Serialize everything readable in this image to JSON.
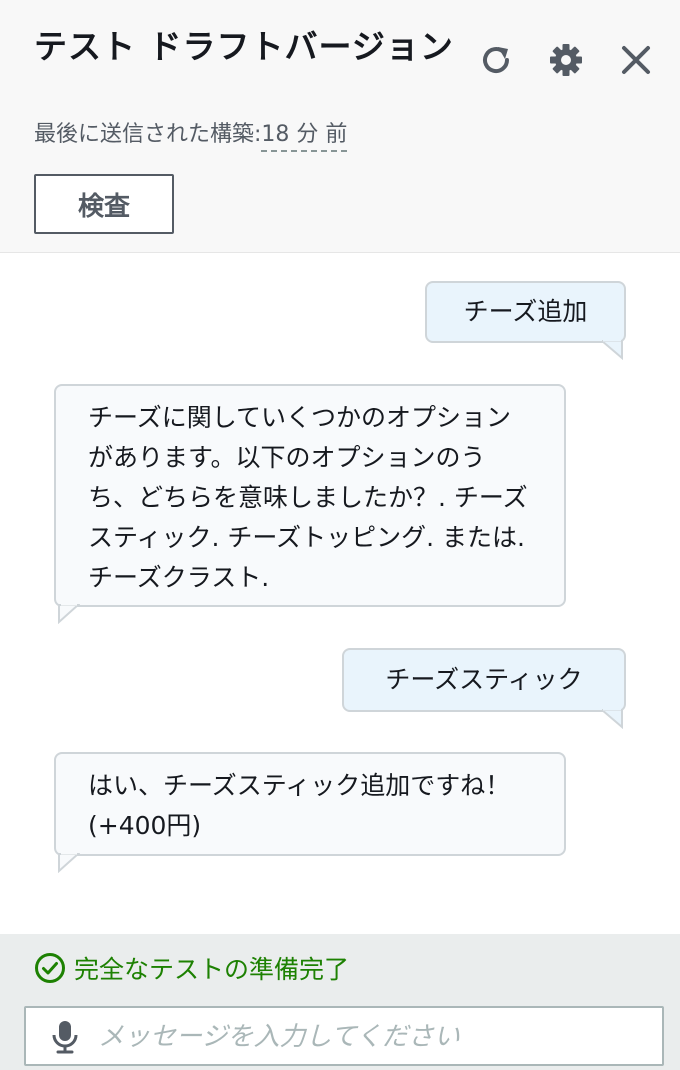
{
  "header": {
    "title": "テスト ドラフトバージョン",
    "subtitle_label": "最後に送信された構築:",
    "subtitle_time": "18 分 前",
    "inspect_button": "検査"
  },
  "icons": {
    "refresh": "refresh-icon",
    "settings": "gear-icon",
    "close": "close-icon",
    "status": "check-circle-icon",
    "mic": "microphone-icon"
  },
  "messages": [
    {
      "role": "user",
      "text": "チーズ追加"
    },
    {
      "role": "bot",
      "text": "チーズに関していくつかのオプションがあります。以下のオプションのうち、どちらを意味しましたか？. チーズスティック. チーズトッピング. または. チーズクラスト."
    },
    {
      "role": "user",
      "text": "チーズスティック"
    },
    {
      "role": "bot",
      "text": "はい、チーズスティック追加ですね！(+400円)"
    }
  ],
  "footer": {
    "status": "完全なテストの準備完了",
    "input_placeholder": "メッセージを入力してください",
    "input_value": ""
  },
  "colors": {
    "status_green": "#1d8102",
    "user_bubble": "#e9f4fc",
    "bot_bubble": "#f8fafc",
    "header_bg": "#f8f8f8",
    "footer_bg": "#eaeded"
  }
}
